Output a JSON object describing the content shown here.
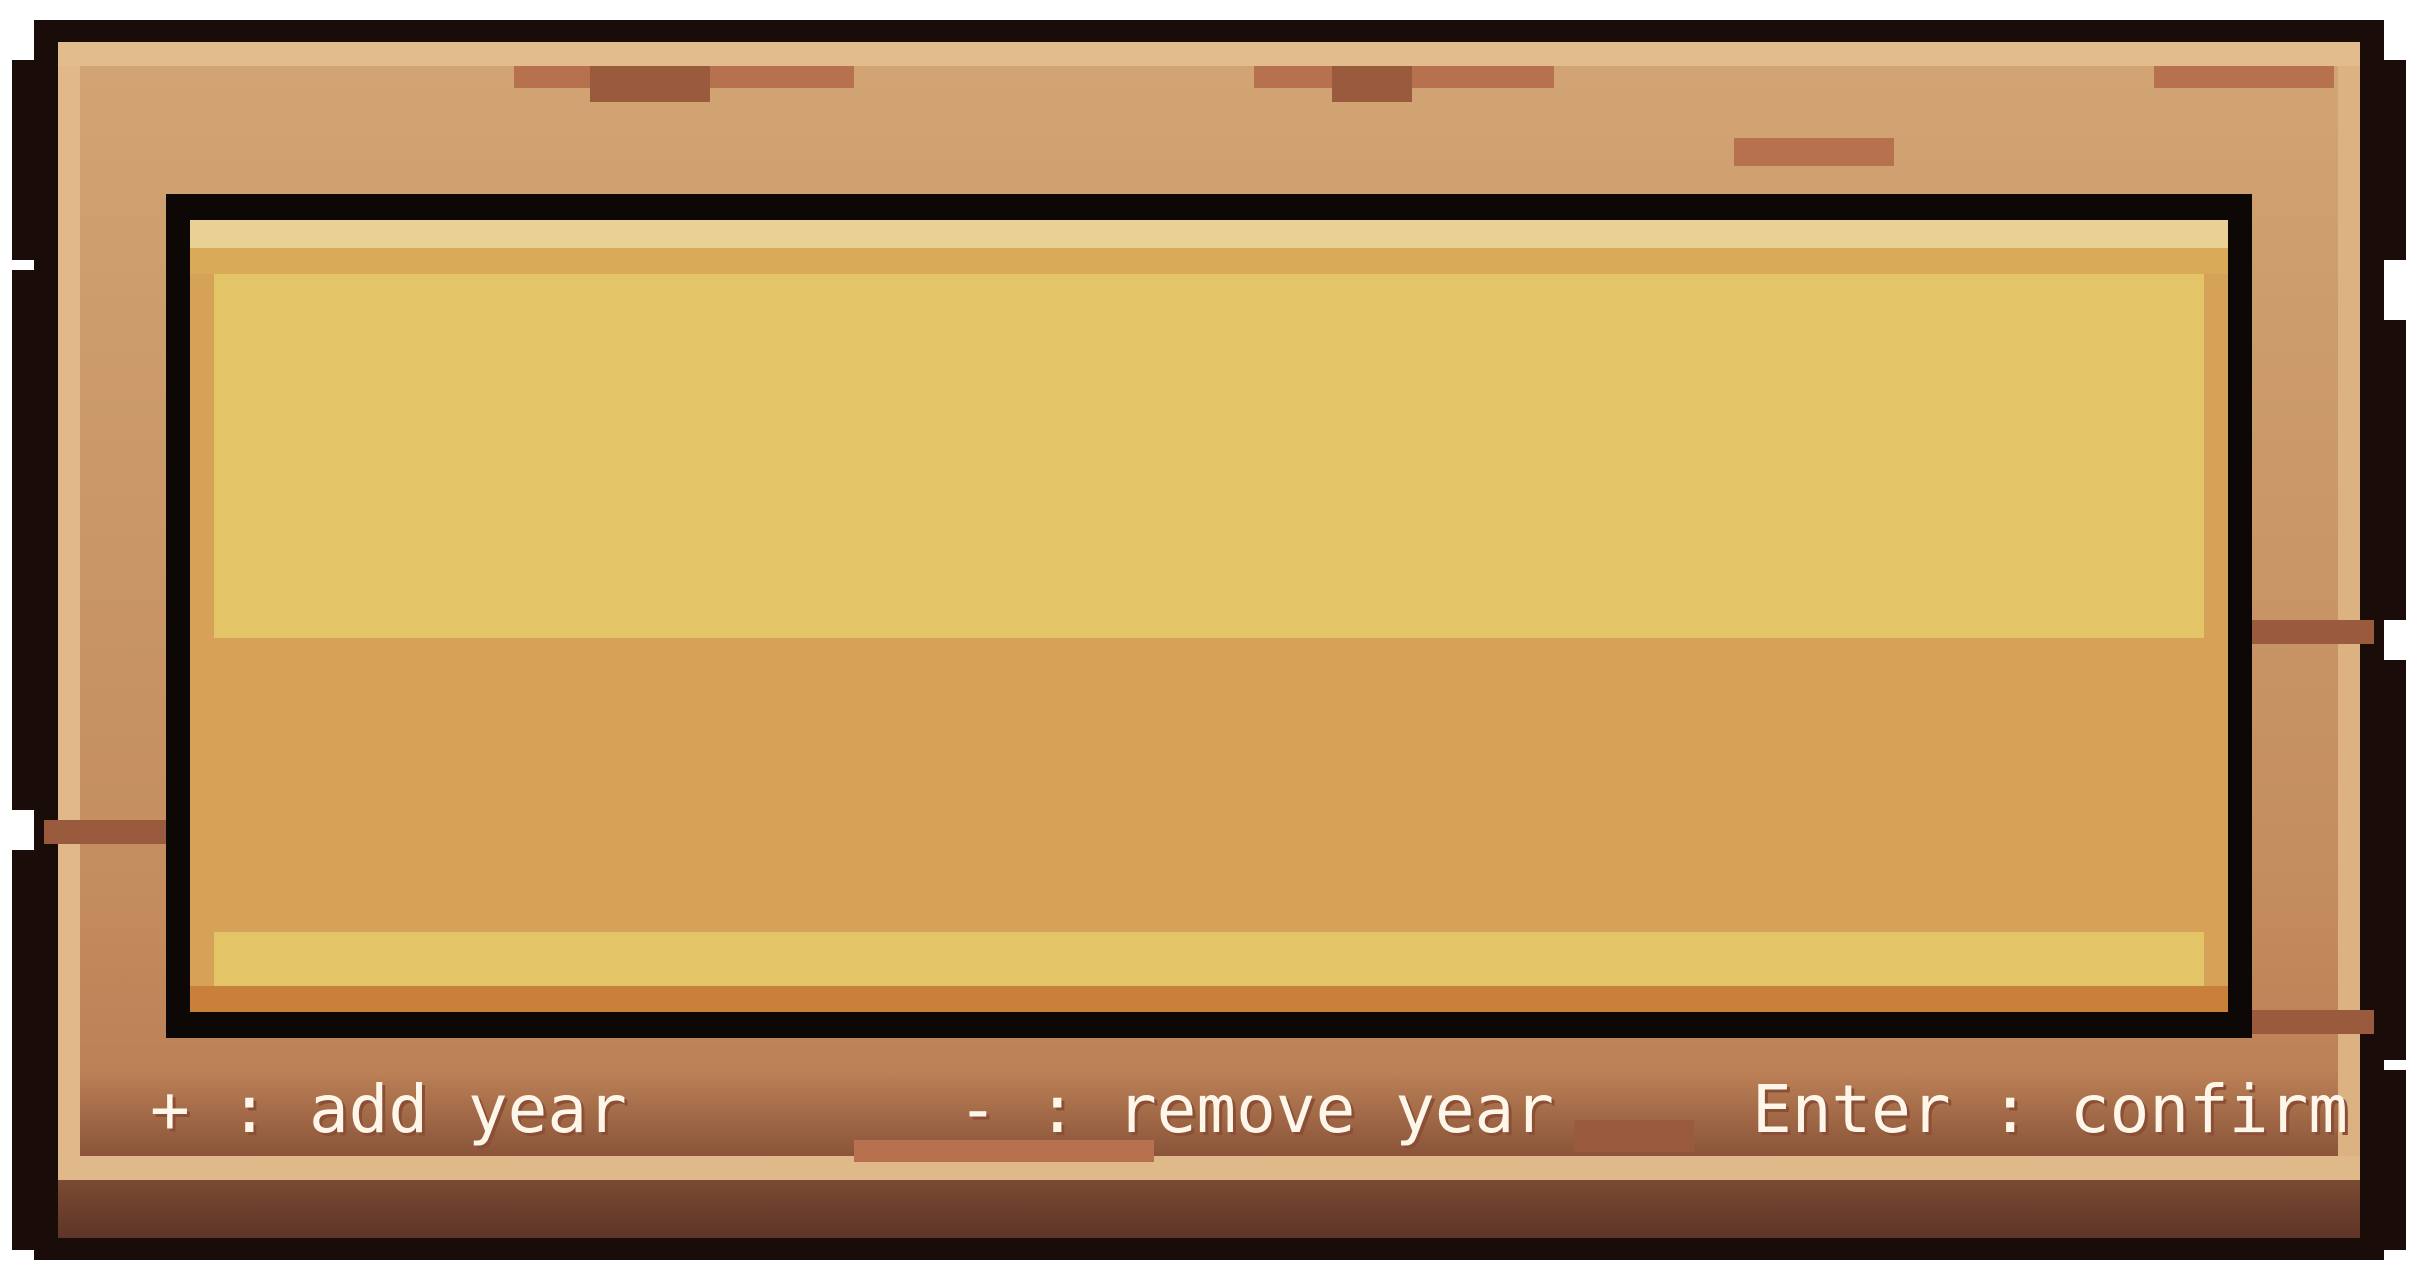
{
  "hints": {
    "add": "+ : add year",
    "remove": "- : remove year",
    "confirm": "Enter : confirm"
  },
  "colors": {
    "frame_outline": "#1a0c08",
    "wood_light": "#d3a574",
    "wood_dark": "#6a3e2c",
    "panel_gold_light": "#e3c466",
    "panel_gold_dark": "#d5a257",
    "hint_text": "#fff6ea"
  }
}
